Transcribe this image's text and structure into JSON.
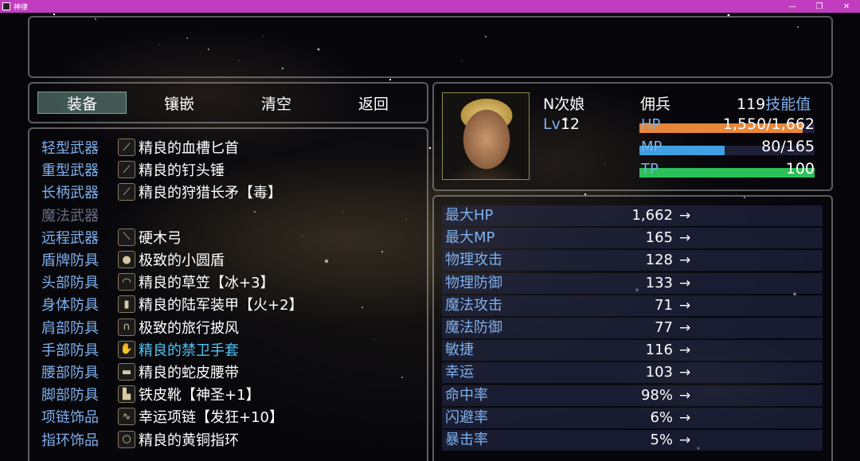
{
  "window": {
    "title": "神律"
  },
  "commands": [
    "装备",
    "镶嵌",
    "清空",
    "返回"
  ],
  "slots": [
    {
      "type": "轻型武器",
      "item": "精良的血槽匕首",
      "icon": "dagger-icon",
      "glyph": "⟋"
    },
    {
      "type": "重型武器",
      "item": "精良的钉头锤",
      "icon": "mace-icon",
      "glyph": "⟋"
    },
    {
      "type": "长柄武器",
      "item": "精良的狩猎长矛【毒】",
      "icon": "spear-icon",
      "glyph": "⟋"
    },
    {
      "type": "魔法武器",
      "item": "",
      "icon": "",
      "glyph": "",
      "disabled": true
    },
    {
      "type": "远程武器",
      "item": "硬木弓",
      "icon": "bow-icon",
      "glyph": "⟍"
    },
    {
      "type": "盾牌防具",
      "item": "极致的小圆盾",
      "icon": "shield-icon",
      "glyph": "●"
    },
    {
      "type": "头部防具",
      "item": "精良的草笠【冰+3】",
      "icon": "hat-icon",
      "glyph": "◠"
    },
    {
      "type": "身体防具",
      "item": "精良的陆军装甲【火+2】",
      "icon": "armor-icon",
      "glyph": "▮"
    },
    {
      "type": "肩部防具",
      "item": "极致的旅行披风",
      "icon": "cloak-icon",
      "glyph": "∩"
    },
    {
      "type": "手部防具",
      "item": "精良的禁卫手套",
      "icon": "glove-icon",
      "glyph": "✋",
      "highlight": true
    },
    {
      "type": "腰部防具",
      "item": "精良的蛇皮腰带",
      "icon": "belt-icon",
      "glyph": "▬"
    },
    {
      "type": "脚部防具",
      "item": "铁皮靴【神圣+1】",
      "icon": "boot-icon",
      "glyph": "▙"
    },
    {
      "type": "项链饰品",
      "item": "幸运项链【发狂+10】",
      "icon": "necklace-icon",
      "glyph": "∿"
    },
    {
      "type": "指环饰品",
      "item": "精良的黄铜指环",
      "icon": "ring-icon",
      "glyph": "○"
    }
  ],
  "actor": {
    "name": "N次娘",
    "class": "佣兵",
    "level_label": "Lv",
    "level": "12",
    "skill_points": "119",
    "skill_points_label": "技能值",
    "hp_label": "HP",
    "hp_text": "1,550/1,662",
    "hp_ratio": 0.9326,
    "mp_label": "MP",
    "mp_text": "80/165",
    "mp_ratio": 0.4848,
    "tp_label": "TP",
    "tp_text": "100",
    "tp_ratio": 1.0
  },
  "colors": {
    "hp": "#e8873a",
    "mp": "#3f9fe0",
    "tp": "#2cc05a",
    "system": "#7fb0ec",
    "titlebar": "#c23cc0"
  },
  "params": [
    {
      "name": "最大HP",
      "value": "1,662"
    },
    {
      "name": "最大MP",
      "value": "165"
    },
    {
      "name": "物理攻击",
      "value": "128"
    },
    {
      "name": "物理防御",
      "value": "133"
    },
    {
      "name": "魔法攻击",
      "value": "71"
    },
    {
      "name": "魔法防御",
      "value": "77"
    },
    {
      "name": "敏捷",
      "value": "116"
    },
    {
      "name": "幸运",
      "value": "103"
    },
    {
      "name": "命中率",
      "value": "98%"
    },
    {
      "name": "闪避率",
      "value": "6%"
    },
    {
      "name": "暴击率",
      "value": "5%"
    }
  ],
  "param_arrow": "→"
}
